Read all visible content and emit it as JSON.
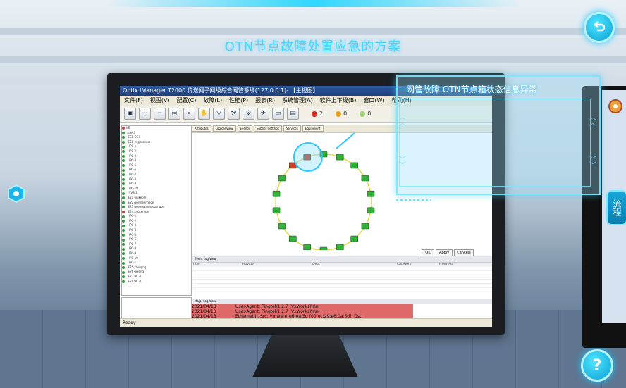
{
  "scene": {
    "title": "OTN节点故障处置应急的方案",
    "back_icon": "return-arrow-icon",
    "help_label": "?",
    "side_tab_label": "流程"
  },
  "app": {
    "window_title": "Optix IManager T2000 传送网子网级综合网管系统(127.0.0.1)- 【主视图】",
    "menu": [
      "文件(F)",
      "视图(V)",
      "配置(C)",
      "故障(L)",
      "性能(P)",
      "报表(R)",
      "系统管理(A)",
      "软件上下线(B)",
      "窗口(W)",
      "帮助(H)"
    ],
    "alarm_counts": {
      "critical": "2",
      "major": "0",
      "minor": "0"
    },
    "tabs": [
      "Attributes",
      "Logical View",
      "Events",
      "Subnet Settings",
      "Services",
      "Equipment"
    ],
    "buttons": {
      "ok": "OK",
      "apply": "Apply",
      "cancel": "Cancels"
    },
    "event_log_title": "Event Log View",
    "event_columns": [
      "Title",
      "Provider",
      "Dept",
      "Category",
      "FreeFeld"
    ],
    "alarm_log_title": "Major Log View",
    "alarm_rows": [
      {
        "date": "2021/04/13",
        "text": "User-Agent: Pingtel/1.2.7 (VxWorks)\\r\\n"
      },
      {
        "date": "2021/04/13",
        "text": "User-Agent: Pingtel/1.2.7 (VxWorks)\\r\\n"
      },
      {
        "date": "2021/04/13",
        "text": "Ethernet II, Src: Vmware_e6:0a:5d (00:0c:29:e6:0a:5d), Dst:"
      }
    ],
    "status": "Ready"
  },
  "info_panel": {
    "message": "网管故障,OTN节点箱状态信息异常"
  },
  "colors": {
    "accent": "#1ac8ff",
    "alarm_row": "#e06a6a",
    "node_green": "#33b23a",
    "node_red": "#d23b2b"
  }
}
